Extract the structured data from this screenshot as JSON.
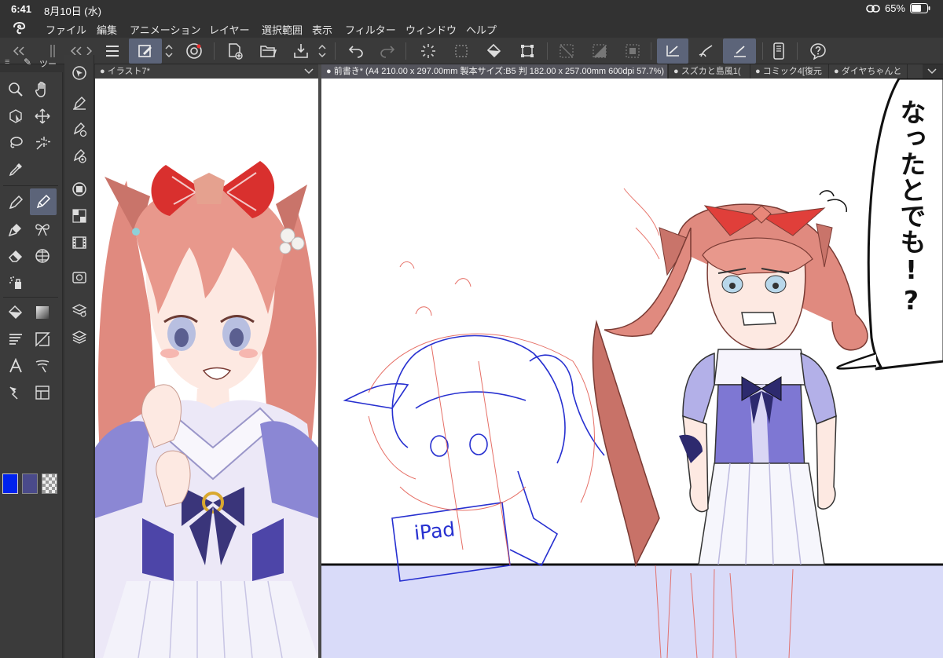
{
  "status_bar": {
    "time": "6:41",
    "date": "8月10日 (水)",
    "battery": "65%"
  },
  "menu": [
    "ファイル",
    "編集",
    "アニメーション",
    "レイヤー",
    "選択範囲",
    "表示",
    "フィルター",
    "ウィンドウ",
    "ヘルプ"
  ],
  "tool_panel": {
    "tab_label": "ツー",
    "colors": {
      "main": "#0022ee",
      "sub": "#4a4a8a",
      "transparent": "checker"
    }
  },
  "tabs": {
    "left": "● イラスト7*",
    "active": "● 前書き* (A4 210.00 x 297.00mm 製本サイズ:B5 判 182.00 x 257.00mm 600dpi 57.7%)",
    "others": [
      "● スズカと島風1(",
      "● コミック4[復元",
      "● ダイヤちゃんと"
    ]
  },
  "canvas": {
    "speech_bubble": "なったとでも!?",
    "sketch_label": "iPad"
  },
  "colors": {
    "ui_bg": "#3b3b3b",
    "accent_selected": "#5c6479",
    "panel_floor": "#d9dbf9"
  }
}
